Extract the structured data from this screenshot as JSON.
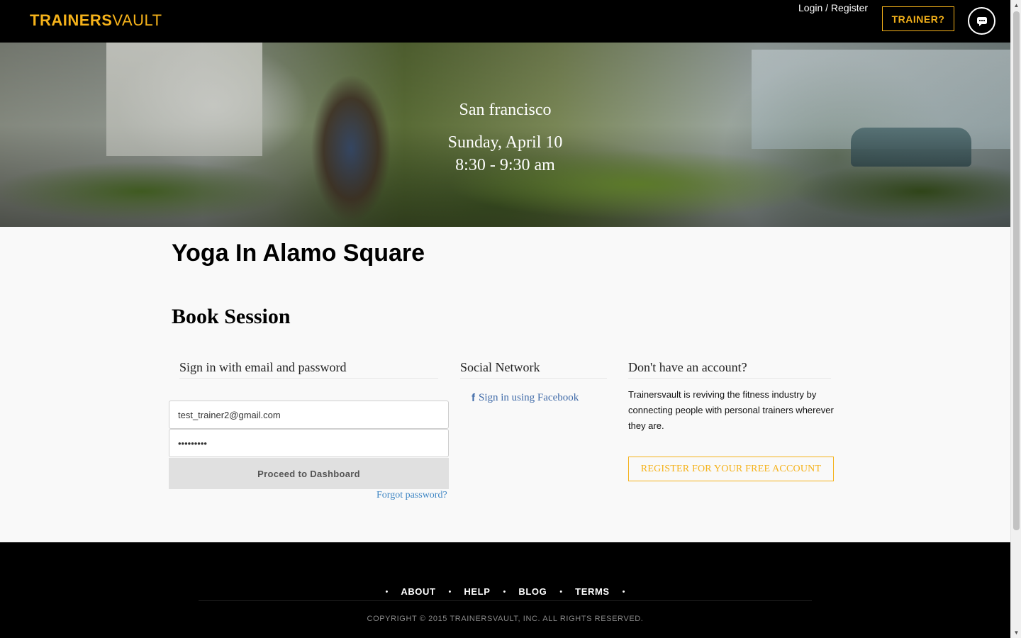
{
  "header": {
    "logo_bold": "TRAINERS",
    "logo_light": "VAULT",
    "login_register": "Login / Register",
    "trainer_button": "TRAINER?",
    "chat_icon": "chat-bubble-icon"
  },
  "hero": {
    "city": "San francisco",
    "date": "Sunday, April 10",
    "time": "8:30 - 9:30 am"
  },
  "main": {
    "title": "Yoga In Alamo Square",
    "book_heading": "Book Session"
  },
  "signin": {
    "heading": "Sign in with email and password",
    "email_value": "test_trainer2@gmail.com",
    "password_value": "•••••••••",
    "proceed_button": "Proceed to Dashboard",
    "forgot_link": "Forgot password?"
  },
  "social": {
    "heading": "Social Network",
    "facebook_icon": "facebook-icon",
    "facebook_link": "Sign in using Facebook"
  },
  "register": {
    "heading": "Don't have an account?",
    "description": "Trainersvault is reviving the fitness industry by connecting people with personal trainers wherever they are.",
    "button": "REGISTER FOR YOUR FREE ACCOUNT"
  },
  "footer": {
    "links": [
      "ABOUT",
      "HELP",
      "BLOG",
      "TERMS"
    ],
    "copyright": "COPYRIGHT © 2015 TRAINERSVAULT, INC. ALL RIGHTS RESERVED."
  },
  "colors": {
    "brand_yellow": "#f5b21a",
    "header_bg": "#000000",
    "link_blue": "#3f86c4",
    "facebook_blue": "#3f6aa8"
  }
}
